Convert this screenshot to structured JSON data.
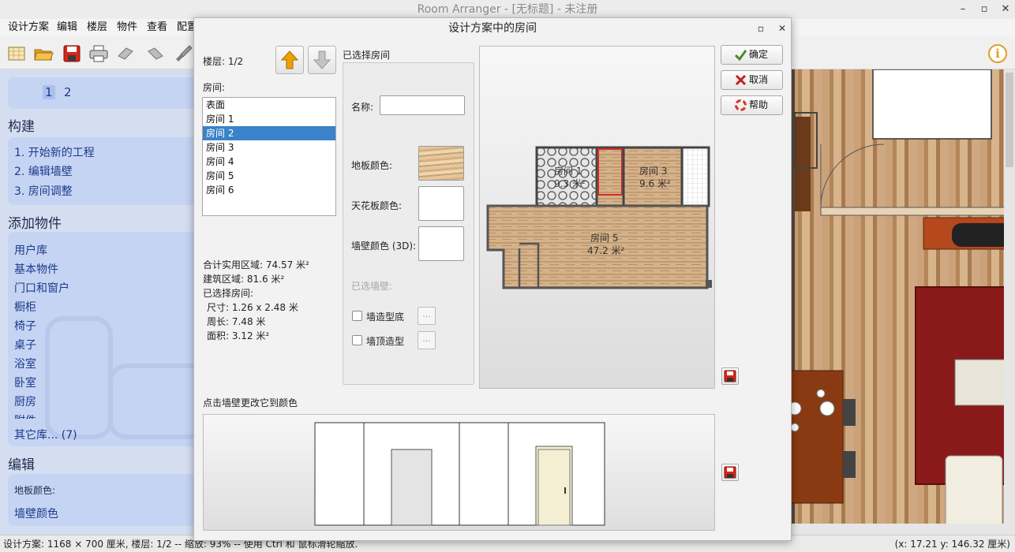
{
  "window": {
    "title": "Room Arranger - [无标题] - 未注册",
    "minimize_glyph": "–",
    "maximize_glyph": "▫",
    "close_glyph": "✕"
  },
  "menu": [
    "设计方案",
    "编辑",
    "楼层",
    "物件",
    "查看",
    "配置"
  ],
  "toolbar_icons": [
    "new-plan-icon",
    "open-folder-icon",
    "save-icon",
    "print-icon",
    "undo-icon",
    "redo-icon",
    "brush-icon",
    "info-icon"
  ],
  "info_glyph": "i",
  "left_panel": {
    "floor_label": "楼层",
    "floors": [
      "1",
      "2"
    ],
    "selected_floor": "1",
    "build_heading": "构建",
    "build_items": [
      "1. 开始新的工程",
      "2. 编辑墙壁",
      "3. 房间调整"
    ],
    "add_objects_heading": "添加物件",
    "object_categories": [
      "用户库",
      "基本物件",
      "门口和窗户",
      "橱柜",
      "椅子",
      "桌子",
      "浴室",
      "卧室",
      "厨房",
      "附件"
    ],
    "other_libraries": "其它库... (7)",
    "edit_heading": "编辑",
    "floor_color_label": "地板颜色:",
    "wall_color_label": "墙壁颜色"
  },
  "status_bar": {
    "left": "设计方案: 1168 × 700 厘米, 楼层: 1/2 -- 缩放: 93% -- 使用 Ctrl 和 鼠标滑轮缩放.",
    "right": "(x: 17.21 y: 146.32 厘米)"
  },
  "dialog": {
    "title": "设计方案中的房间",
    "maximize_glyph": "▫",
    "close_glyph": "✕",
    "floor_label": "楼层: 1/2",
    "rooms_label": "房间:",
    "rooms": [
      "表面",
      "房间 1",
      "房间 2",
      "房间 3",
      "房间 4",
      "房间 5",
      "房间 6"
    ],
    "selected_room": "房间 2",
    "stats": {
      "total_usable": "合计实用区域: 74.57 米²",
      "built_area": "建筑区域: 81.6 米²",
      "selected_room_heading": "已选择房间:",
      "size": "尺寸: 1.26 x 2.48 米",
      "perimeter": "周长: 7.48 米",
      "area": "面积: 3.12 米²"
    },
    "selected_group": {
      "title": "已选择房间",
      "name_label": "名称:",
      "name_value": "",
      "floor_color_label": "地板颜色:",
      "ceiling_color_label": "天花板颜色:",
      "wall_color_label": "墙壁颜色 (3D):",
      "selected_wall_label": "已选墙壁:",
      "skirting_label": "墙造型底",
      "skirting_checked": false,
      "cornice_label": "墙顶造型",
      "cornice_checked": false,
      "dots": "..."
    },
    "preview_rooms": [
      {
        "name": "房间 1",
        "area": "9.3 米²"
      },
      {
        "name": "房间 3",
        "area": "9.6 米²"
      },
      {
        "name": "房间 5",
        "area": "47.2 米²"
      }
    ],
    "buttons": {
      "ok": "确定",
      "cancel": "取消",
      "help": "帮助"
    },
    "wall_hint": "点击墙壁更改它到颜色"
  },
  "colors": {
    "accent": "#3a82c9",
    "left_panel_bg": "#d5def1",
    "link": "#1b3a8a",
    "selected_room_outline": "#d32a2a",
    "ok_icon": "#4a8a2a",
    "cancel_icon": "#c0201a",
    "help_icon": "#d3382e",
    "arrow_orange": "#f0a000"
  }
}
